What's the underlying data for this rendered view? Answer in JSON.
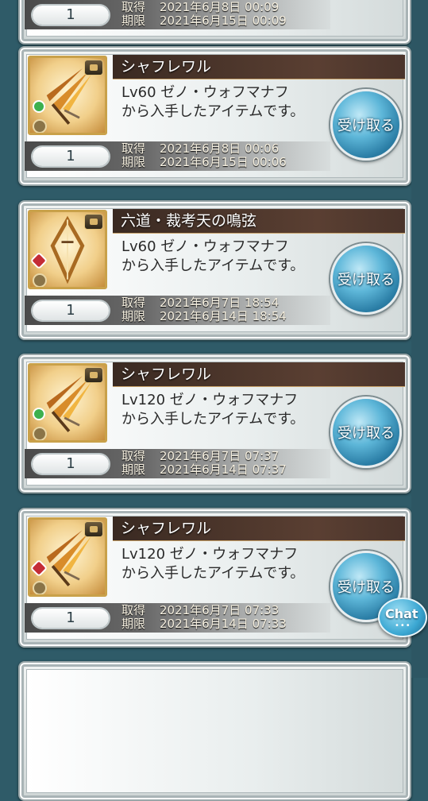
{
  "receive_label": "受け取る",
  "from_label_suffix": "から入手したアイテムです。",
  "acquired_label": "取得",
  "expires_label": "期限",
  "partial_top": {
    "quantity": "1",
    "acquired": "2021年6月8日 00:09",
    "expires": "2021年6月15日 00:09"
  },
  "items": [
    {
      "name": "シャフレワル",
      "source": "Lv60 ゼノ・ウォフマナフ",
      "quantity": "1",
      "acquired": "2021年6月8日 00:06",
      "expires": "2021年6月15日 00:06",
      "element_icon": "green-circle-icon"
    },
    {
      "name": "六道・裁考天の鳴弦",
      "source": "Lv60 ゼノ・ウォフマナフ",
      "quantity": "1",
      "acquired": "2021年6月7日 18:54",
      "expires": "2021年6月14日 18:54",
      "element_icon": "red-diamond-icon"
    },
    {
      "name": "シャフレワル",
      "source": "Lv120 ゼノ・ウォフマナフ",
      "quantity": "1",
      "acquired": "2021年6月7日 07:37",
      "expires": "2021年6月14日 07:37",
      "element_icon": "green-circle-icon"
    },
    {
      "name": "シャフレワル",
      "source": "Lv120 ゼノ・ウォフマナフ",
      "quantity": "1",
      "acquired": "2021年6月7日 07:33",
      "expires": "2021年6月14日 07:33",
      "element_icon": "red-diamond-icon"
    }
  ],
  "chat_label": "Chat"
}
